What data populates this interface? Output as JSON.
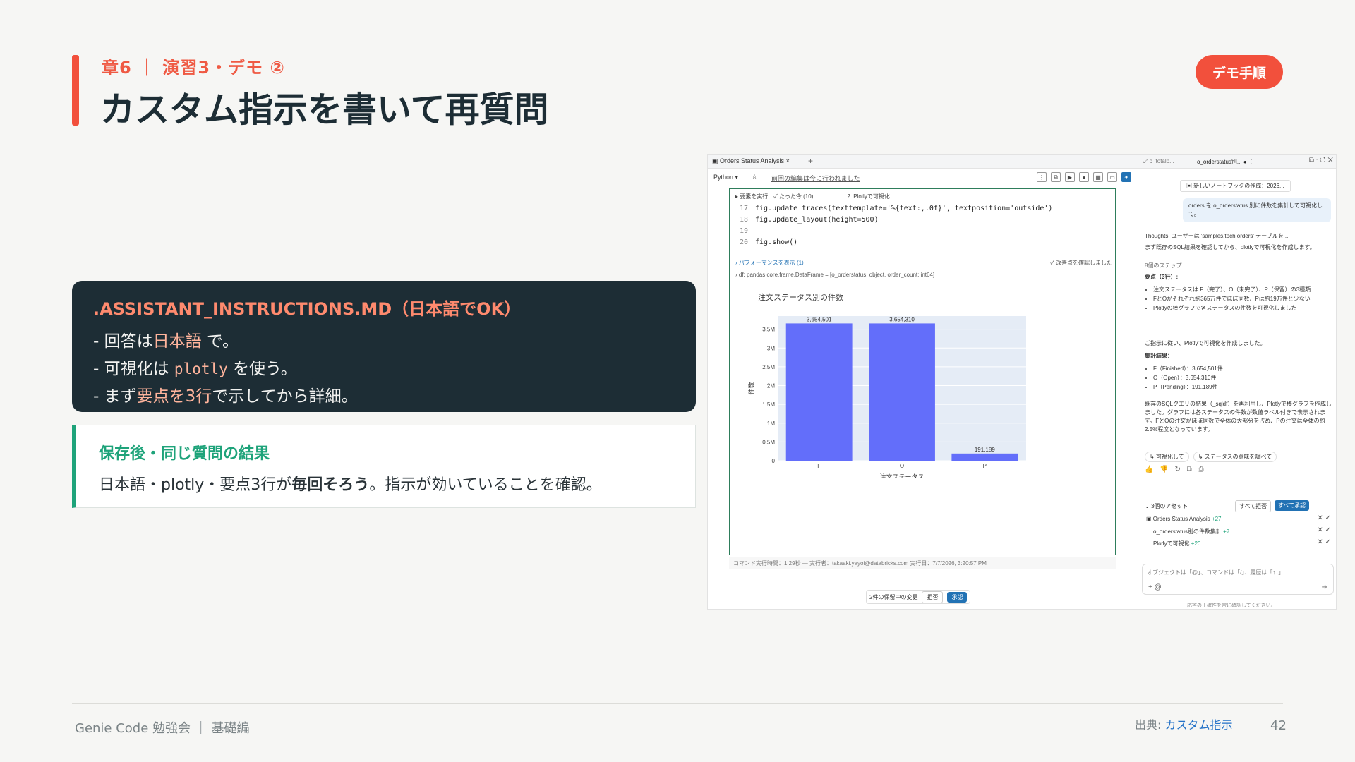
{
  "slide": {
    "eyebrow": "章6 ｜ 演習3・デモ ②",
    "title": "カスタム指示を書いて再質問",
    "badge": "デモ手順",
    "accent_color": "#f2503c"
  },
  "instructions_card": {
    "title": ".ASSISTANT_INSTRUCTIONS.MD（日本語でOK）",
    "line1_prefix": "- 回答は",
    "line1_hl": "日本語",
    "line1_suffix": " で。",
    "line2_prefix": "- 可視化は ",
    "line2_code": "plotly",
    "line2_suffix": " を使う。",
    "line3_prefix": "- まず",
    "line3_hl": "要点を3行",
    "line3_suffix": "で示してから詳細。"
  },
  "result_card": {
    "title": "保存後・同じ質問の結果",
    "text_prefix": "日本語・plotly・要点3行が",
    "text_bold": "毎回そろう",
    "text_suffix": "。指示が効いていることを確認。",
    "accent_color": "#1ea37a"
  },
  "screenshot": {
    "notebook_tab": "Orders Status Analysis",
    "language": "Python",
    "saved_status": "前回の編集は今に行われました",
    "cell_header": "▸ 要素を実行　✓ たった今 (10)　　　　　　2. Plotlyで可視化",
    "code": [
      {
        "ln": "17",
        "text": "fig.update_traces(texttemplate='%{text:,.0f}', textposition='outside')"
      },
      {
        "ln": "18",
        "text": "fig.update_layout(height=500)"
      },
      {
        "ln": "19",
        "text": ""
      },
      {
        "ln": "20",
        "text": "fig.show()"
      }
    ],
    "perf_label": "›  パフォーマンスを表示 (1)",
    "perf_right": "✓ 改善点を確認しました",
    "df_line": "›  df:  pandas.core.frame.DataFrame = [o_orderstatus: object, order_count: int64]",
    "cell_footer": "コマンド実行時間：1.29秒 — 実行者：takaaki.yayoi@databricks.com 実行日：7/7/2026, 3:20:57 PM",
    "bottom_bar": {
      "label": "2件の保留中の変更",
      "reject": "拒否",
      "accept": "承認"
    },
    "assistant": {
      "tab1": "o_totalp...",
      "tab2": "o_orderstatus別...",
      "new_notebook": "新しいノートブックの作成：2026...",
      "user_msg": "orders を o_orderstatus 別に件数を集計して可視化して。",
      "thoughts": "Thoughts: ユーザーは 'samples.tpch.orders' テーブルを ...",
      "intro": "まず既存のSQL結果を確認してから、plotlyで可視化を作成します。",
      "steps": "8個のステップ",
      "summary_title": "要点（3行）:",
      "summary": [
        "注文ステータスは F（完了）、O（未完了）、P（保留）の3種類",
        "FとOがそれぞれ約365万件でほぼ同数、Pは約19万件と少ない",
        "Plotlyの棒グラフで各ステータスの件数を可視化しました"
      ],
      "done_msg": "ご指示に従い、Plotlyで可視化を作成しました。",
      "results_title": "集計結果：",
      "results": [
        "F（Finished）：3,654,501件",
        "O（Open）：3,654,310件",
        "P（Pending）：191,189件"
      ],
      "detail": "既存のSQLクエリの結果（_sqldf）を再利用し、Plotlyで棒グラフを作成しました。グラフには各ステータスの件数が数値ラベル付きで表示されます。FとOの注文がほぼ同数で全体の大部分を占め、Pの注文は全体の約2.5%程度となっています。",
      "chip1": "↳ 可視化して",
      "chip2": "↳ ステータスの意味を調べて",
      "feedback_icons": "👍 👎 ↻ ⧉ ⎙",
      "assets_label": "3個のアセット",
      "reject_all": "すべて拒否",
      "accept_all": "すべて承認",
      "assets": [
        {
          "name": "Orders Status Analysis",
          "count": "+27"
        },
        {
          "name": "o_orderstatus別の件数集計",
          "count": "+7"
        },
        {
          "name": "Plotlyで可視化",
          "count": "+20"
        }
      ],
      "prompt_placeholder": "オブジェクトは「@」、コマンドは「/」、履歴は「↑↓」",
      "disclaimer": "応答の正確性を常に確認してください。"
    }
  },
  "chart_data": {
    "type": "bar",
    "title": "注文ステータス別の件数",
    "categories": [
      "F",
      "O",
      "P"
    ],
    "values": [
      3654501,
      3654310,
      191189
    ],
    "data_labels": [
      "3,654,501",
      "3,654,310",
      "191,189"
    ],
    "xlabel": "注文ステータス",
    "ylabel": "件数",
    "ylim": [
      0,
      3850000
    ],
    "yticks": [
      0,
      500000,
      1000000,
      1500000,
      2000000,
      2500000,
      3000000,
      3500000
    ],
    "ytick_labels": [
      "0",
      "0.5M",
      "1M",
      "1.5M",
      "2M",
      "2.5M",
      "3M",
      "3.5M"
    ],
    "bar_color": "#636efa",
    "plot_bg": "#e5ecf6"
  },
  "footer": {
    "left": "Genie Code 勉強会 ｜ 基礎編",
    "source_prefix": "出典: ",
    "source_link": "カスタム指示",
    "page": "42"
  }
}
